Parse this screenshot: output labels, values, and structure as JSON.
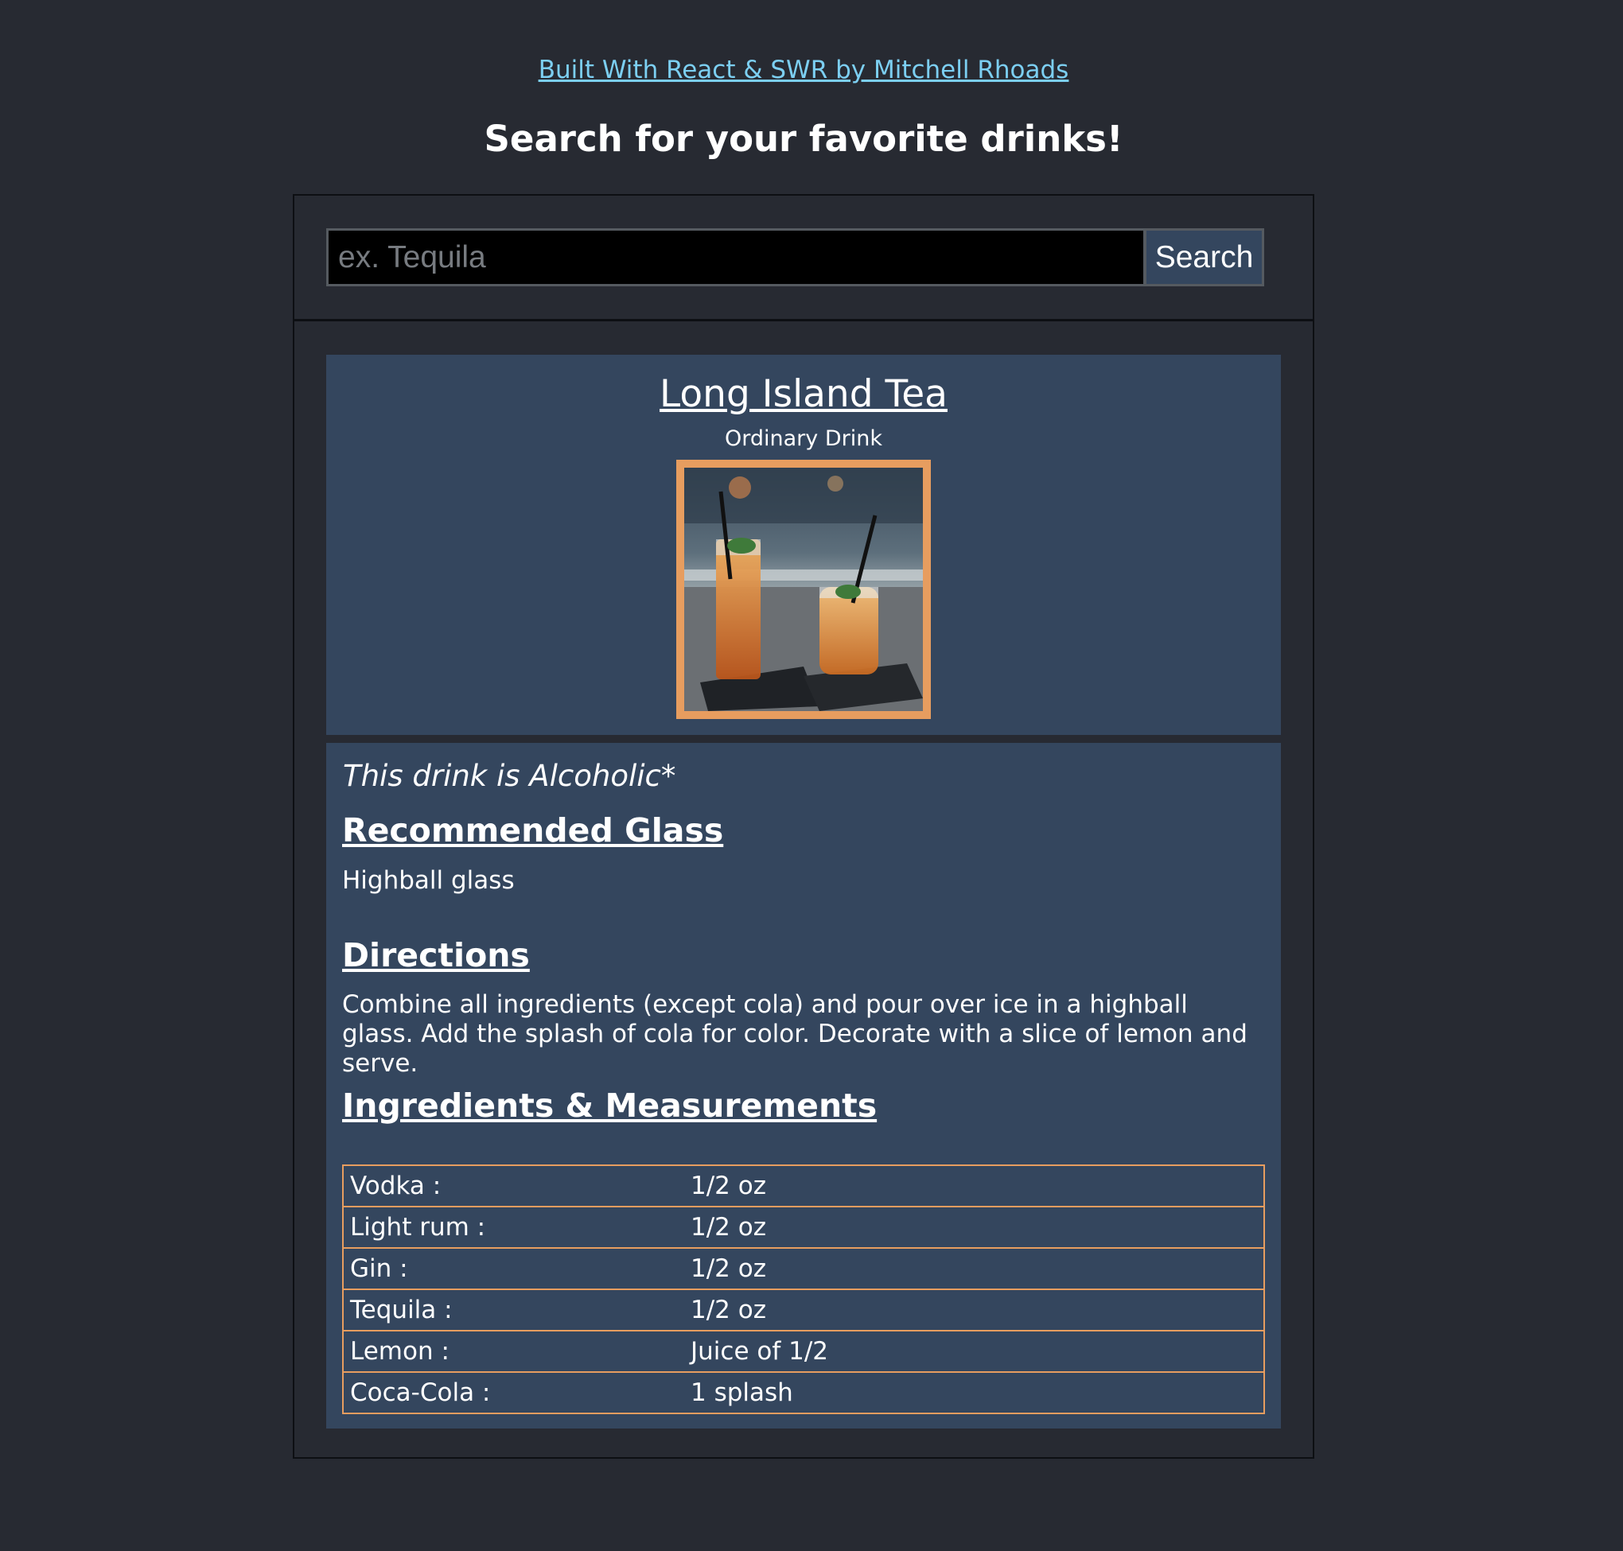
{
  "header": {
    "credit_link": "Built With React & SWR by Mitchell Rhoads",
    "title": "Search for your favorite drinks!"
  },
  "search": {
    "placeholder": "ex. Tequila",
    "value": "",
    "button_label": "Search"
  },
  "drink": {
    "name": "Long Island Tea",
    "category": "Ordinary Drink",
    "image_icon": "cocktail-photo",
    "alcoholic_note": "This drink is Alcoholic*",
    "glass_heading": "Recommended Glass",
    "glass": "Highball glass",
    "directions_heading": "Directions",
    "directions": "Combine all ingredients (except cola) and pour over ice in a highball glass. Add the splash of cola for color. Decorate with a slice of lemon and serve.",
    "ingredients_heading": "Ingredients & Measurements",
    "ingredients": [
      {
        "name": "Vodka :",
        "measure": "1/2 oz"
      },
      {
        "name": "Light rum :",
        "measure": "1/2 oz"
      },
      {
        "name": "Gin :",
        "measure": "1/2 oz"
      },
      {
        "name": "Tequila :",
        "measure": "1/2 oz"
      },
      {
        "name": "Lemon :",
        "measure": "Juice of 1/2"
      },
      {
        "name": "Coca-Cola :",
        "measure": "1 splash"
      }
    ]
  },
  "colors": {
    "background": "#272a32",
    "card": "#34465e",
    "accent_border": "#e79d5f",
    "link": "#7ccff2"
  }
}
